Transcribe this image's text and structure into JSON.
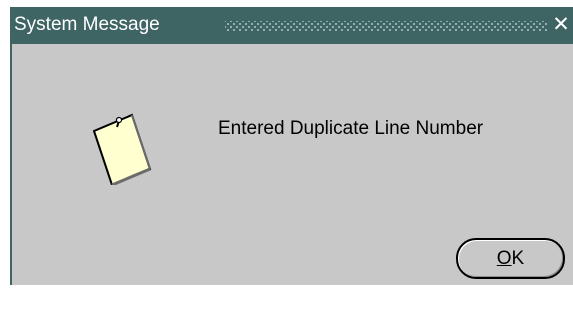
{
  "window": {
    "title": "System Message",
    "close_glyph": "✕"
  },
  "message": {
    "icon": "note-icon",
    "text": "Entered Duplicate Line Number"
  },
  "buttons": {
    "ok_mnemonic": "O",
    "ok_rest": "K"
  },
  "colors": {
    "titlebar": "#3f6464",
    "dialog_background": "#c8c8c8",
    "note_fill": "#ffffd0"
  }
}
